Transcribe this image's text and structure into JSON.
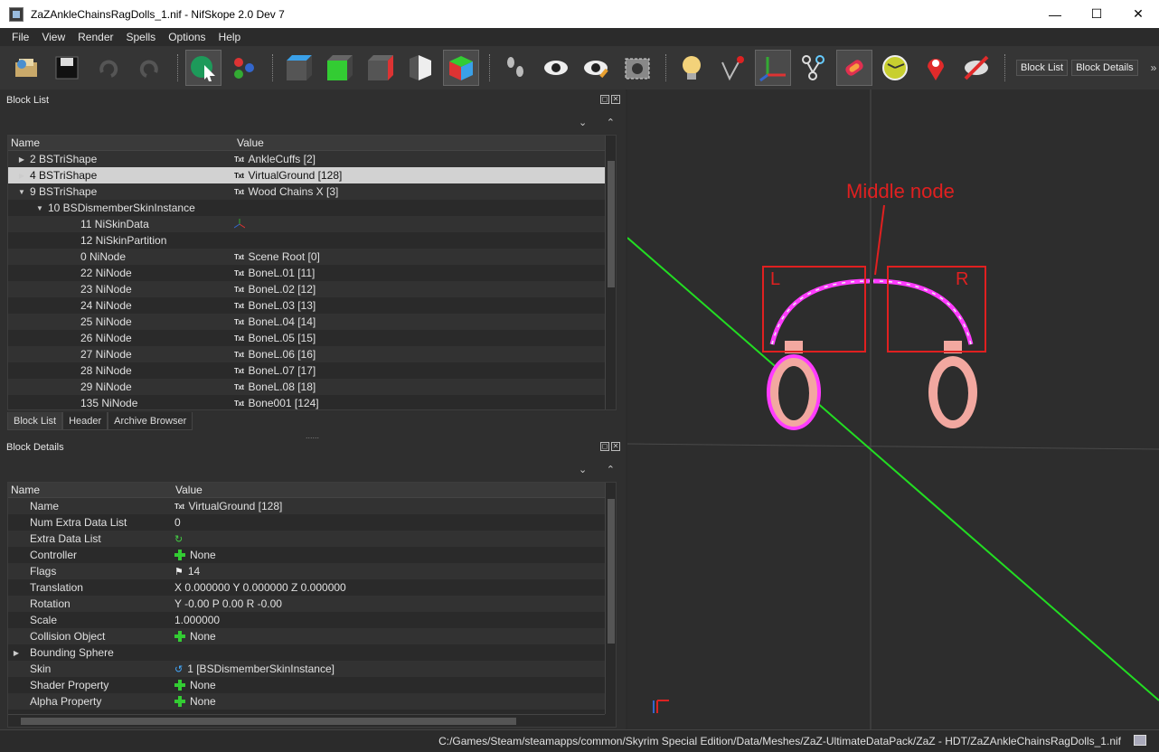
{
  "window": {
    "title": "ZaZAnkleChainsRagDolls_1.nif - NifSkope 2.0 Dev 7"
  },
  "menu": [
    "File",
    "View",
    "Render",
    "Spells",
    "Options",
    "Help"
  ],
  "toolbar": {
    "block_list_label": "Block List",
    "block_details_label": "Block Details"
  },
  "block_list": {
    "title": "Block List",
    "col_name": "Name",
    "col_value": "Value",
    "rows": [
      {
        "name": "2 BSTriShape",
        "value": "AnkleCuffs [2]",
        "indent": 1,
        "exp": "▶",
        "icon": "Txt"
      },
      {
        "name": "4 BSTriShape",
        "value": "VirtualGround [128]",
        "indent": 1,
        "exp": "▶",
        "icon": "Txt",
        "sel": true
      },
      {
        "name": "9 BSTriShape",
        "value": "Wood Chains X [3]",
        "indent": 1,
        "exp": "▼",
        "icon": "Txt"
      },
      {
        "name": "10 BSDismemberSkinInstance",
        "value": "",
        "indent": 2,
        "exp": "▼",
        "icon": ""
      },
      {
        "name": "11 NiSkinData",
        "value": "",
        "indent": 3,
        "exp": "",
        "icon": "axes"
      },
      {
        "name": "12 NiSkinPartition",
        "value": "",
        "indent": 3,
        "exp": "",
        "icon": ""
      },
      {
        "name": "0 NiNode",
        "value": "Scene Root [0]",
        "indent": 3,
        "exp": "",
        "icon": "Txt"
      },
      {
        "name": "22 NiNode",
        "value": "BoneL.01 [11]",
        "indent": 3,
        "exp": "",
        "icon": "Txt"
      },
      {
        "name": "23 NiNode",
        "value": "BoneL.02 [12]",
        "indent": 3,
        "exp": "",
        "icon": "Txt"
      },
      {
        "name": "24 NiNode",
        "value": "BoneL.03 [13]",
        "indent": 3,
        "exp": "",
        "icon": "Txt"
      },
      {
        "name": "25 NiNode",
        "value": "BoneL.04 [14]",
        "indent": 3,
        "exp": "",
        "icon": "Txt"
      },
      {
        "name": "26 NiNode",
        "value": "BoneL.05 [15]",
        "indent": 3,
        "exp": "",
        "icon": "Txt"
      },
      {
        "name": "27 NiNode",
        "value": "BoneL.06 [16]",
        "indent": 3,
        "exp": "",
        "icon": "Txt"
      },
      {
        "name": "28 NiNode",
        "value": "BoneL.07 [17]",
        "indent": 3,
        "exp": "",
        "icon": "Txt"
      },
      {
        "name": "29 NiNode",
        "value": "BoneL.08 [18]",
        "indent": 3,
        "exp": "",
        "icon": "Txt"
      },
      {
        "name": "135 NiNode",
        "value": "Bone001 [124]",
        "indent": 3,
        "exp": "",
        "icon": "Txt"
      }
    ],
    "tabs": [
      "Block List",
      "Header",
      "Archive Browser"
    ]
  },
  "block_details": {
    "title": "Block Details",
    "col_name": "Name",
    "col_value": "Value",
    "rows": [
      {
        "name": "Name",
        "value": "VirtualGround [128]",
        "icon": "Txt"
      },
      {
        "name": "Num Extra Data List",
        "value": "0",
        "icon": ""
      },
      {
        "name": "Extra Data List",
        "value": "",
        "icon": "refresh"
      },
      {
        "name": "Controller",
        "value": "None",
        "icon": "plus"
      },
      {
        "name": "Flags",
        "value": "14",
        "icon": "flag"
      },
      {
        "name": "Translation",
        "value": "X 0.000000 Y 0.000000 Z 0.000000",
        "icon": ""
      },
      {
        "name": "Rotation",
        "value": "Y -0.00 P 0.00 R -0.00",
        "icon": ""
      },
      {
        "name": "Scale",
        "value": "1.000000",
        "icon": ""
      },
      {
        "name": "Collision Object",
        "value": "None",
        "icon": "plus"
      },
      {
        "name": "Bounding Sphere",
        "value": "",
        "icon": "",
        "exp": "▶"
      },
      {
        "name": "Skin",
        "value": "1 [BSDismemberSkinInstance]",
        "icon": "link"
      },
      {
        "name": "Shader Property",
        "value": "None",
        "icon": "plus"
      },
      {
        "name": "Alpha Property",
        "value": "None",
        "icon": "plus"
      }
    ]
  },
  "viewport": {
    "annotation": "Middle node",
    "left_label": "L",
    "right_label": "R"
  },
  "status": {
    "path": "C:/Games/Steam/steamapps/common/Skyrim Special Edition/Data/Meshes/ZaZ-UltimateDataPack/ZaZ - HDT/ZaZAnkleChainsRagDolls_1.nif"
  }
}
